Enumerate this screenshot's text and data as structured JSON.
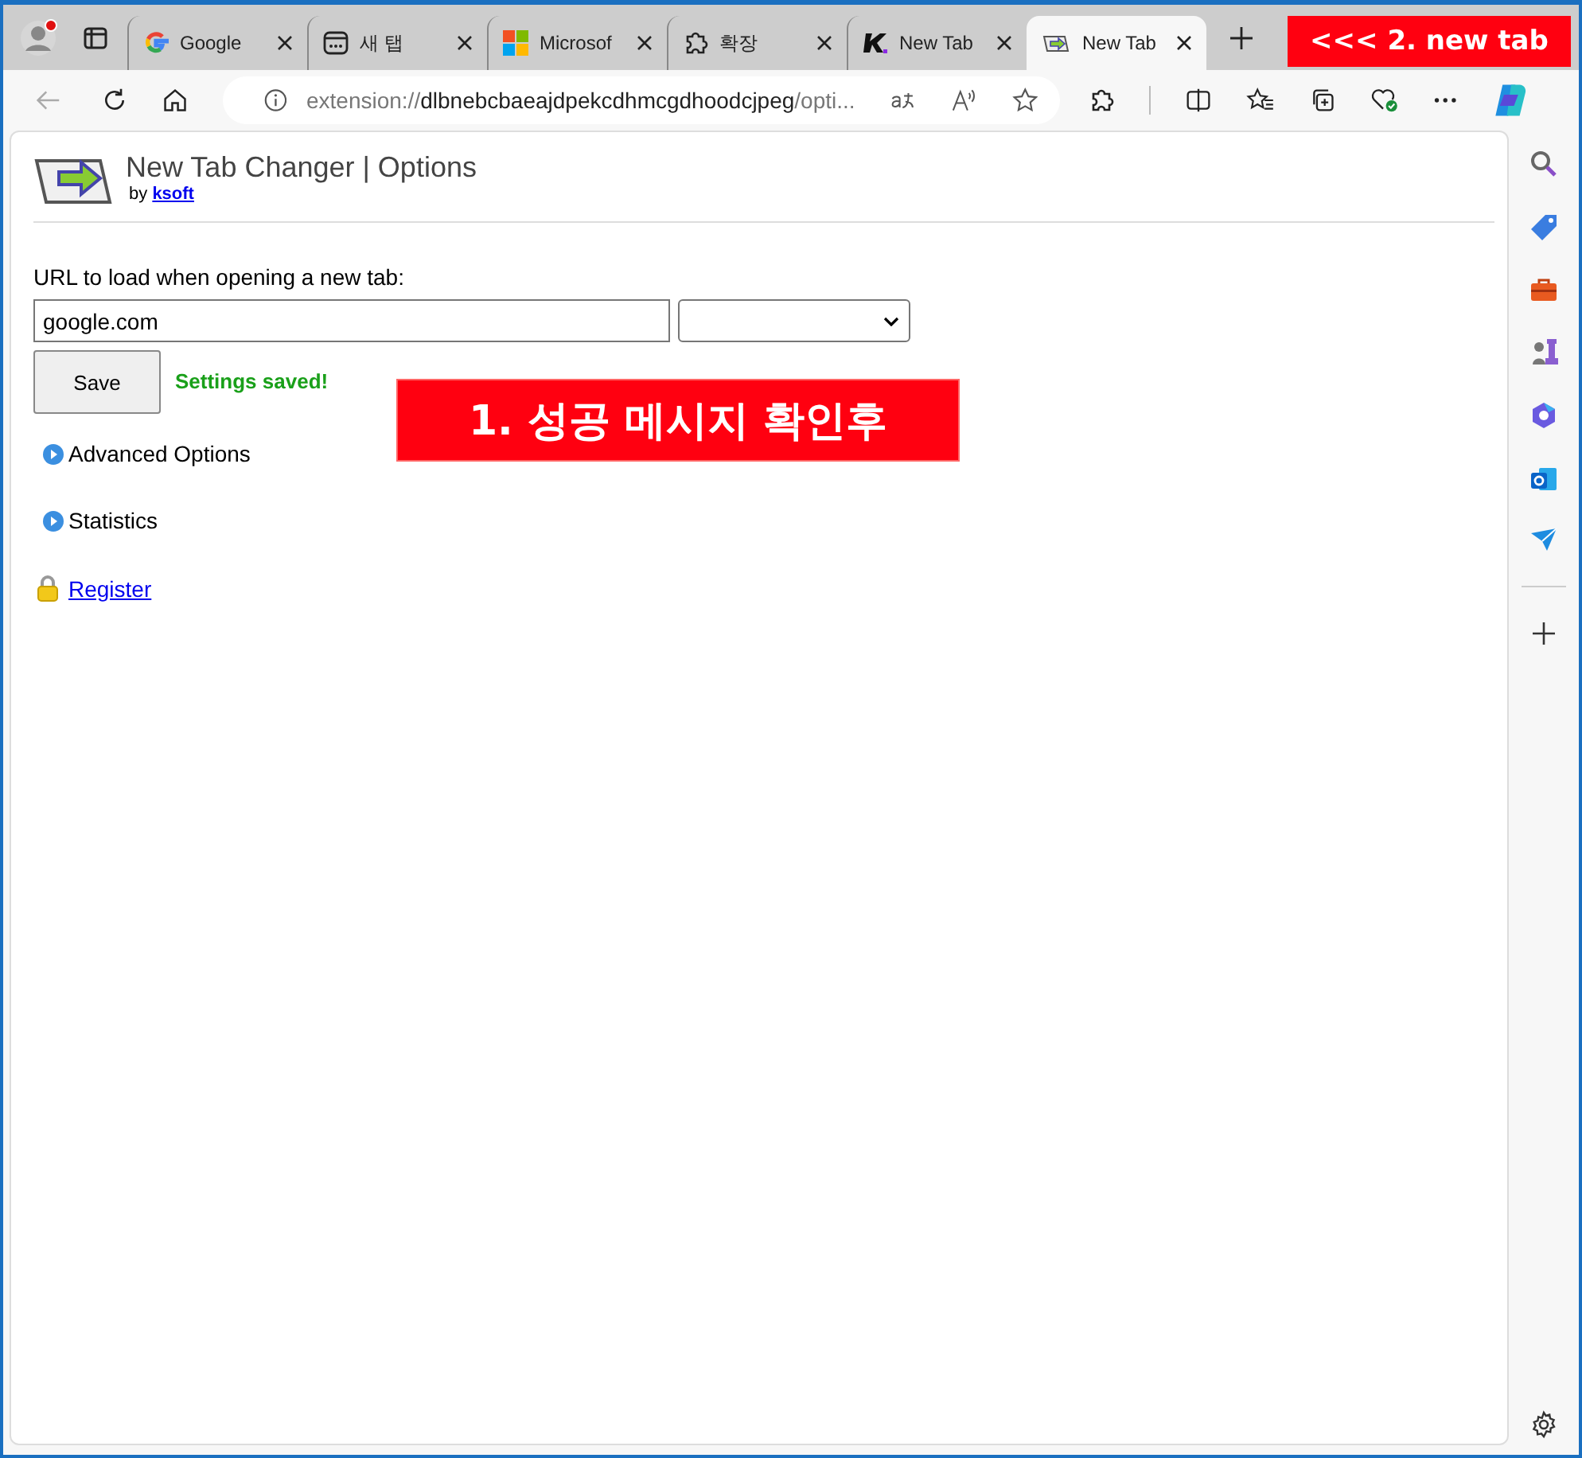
{
  "tabs": [
    {
      "label": "Google",
      "selected": false
    },
    {
      "label": "새 탭",
      "selected": false
    },
    {
      "label": "Microsof",
      "selected": false
    },
    {
      "label": "확장",
      "selected": false
    },
    {
      "label": "New Tab",
      "selected": false
    },
    {
      "label": "New Tab",
      "selected": true
    }
  ],
  "address": {
    "scheme": "extension://",
    "host": "dlbnebcbaeajdpekcdhmcgdhoodcjpeg",
    "path": "/opti..."
  },
  "page": {
    "title": "New Tab Changer | Options",
    "by": "by",
    "author": "ksoft",
    "url_label": "URL to load when opening a new tab:",
    "url_value": "google.com",
    "save": "Save",
    "status": "Settings saved!",
    "sections": [
      {
        "label": "Advanced Options",
        "expanded": false
      },
      {
        "label": "Statistics",
        "expanded": false
      }
    ],
    "register": "Register"
  },
  "tab_annotation": "<<< 2. new tab",
  "page_annotation": "1. 성공 메시지 확인후"
}
